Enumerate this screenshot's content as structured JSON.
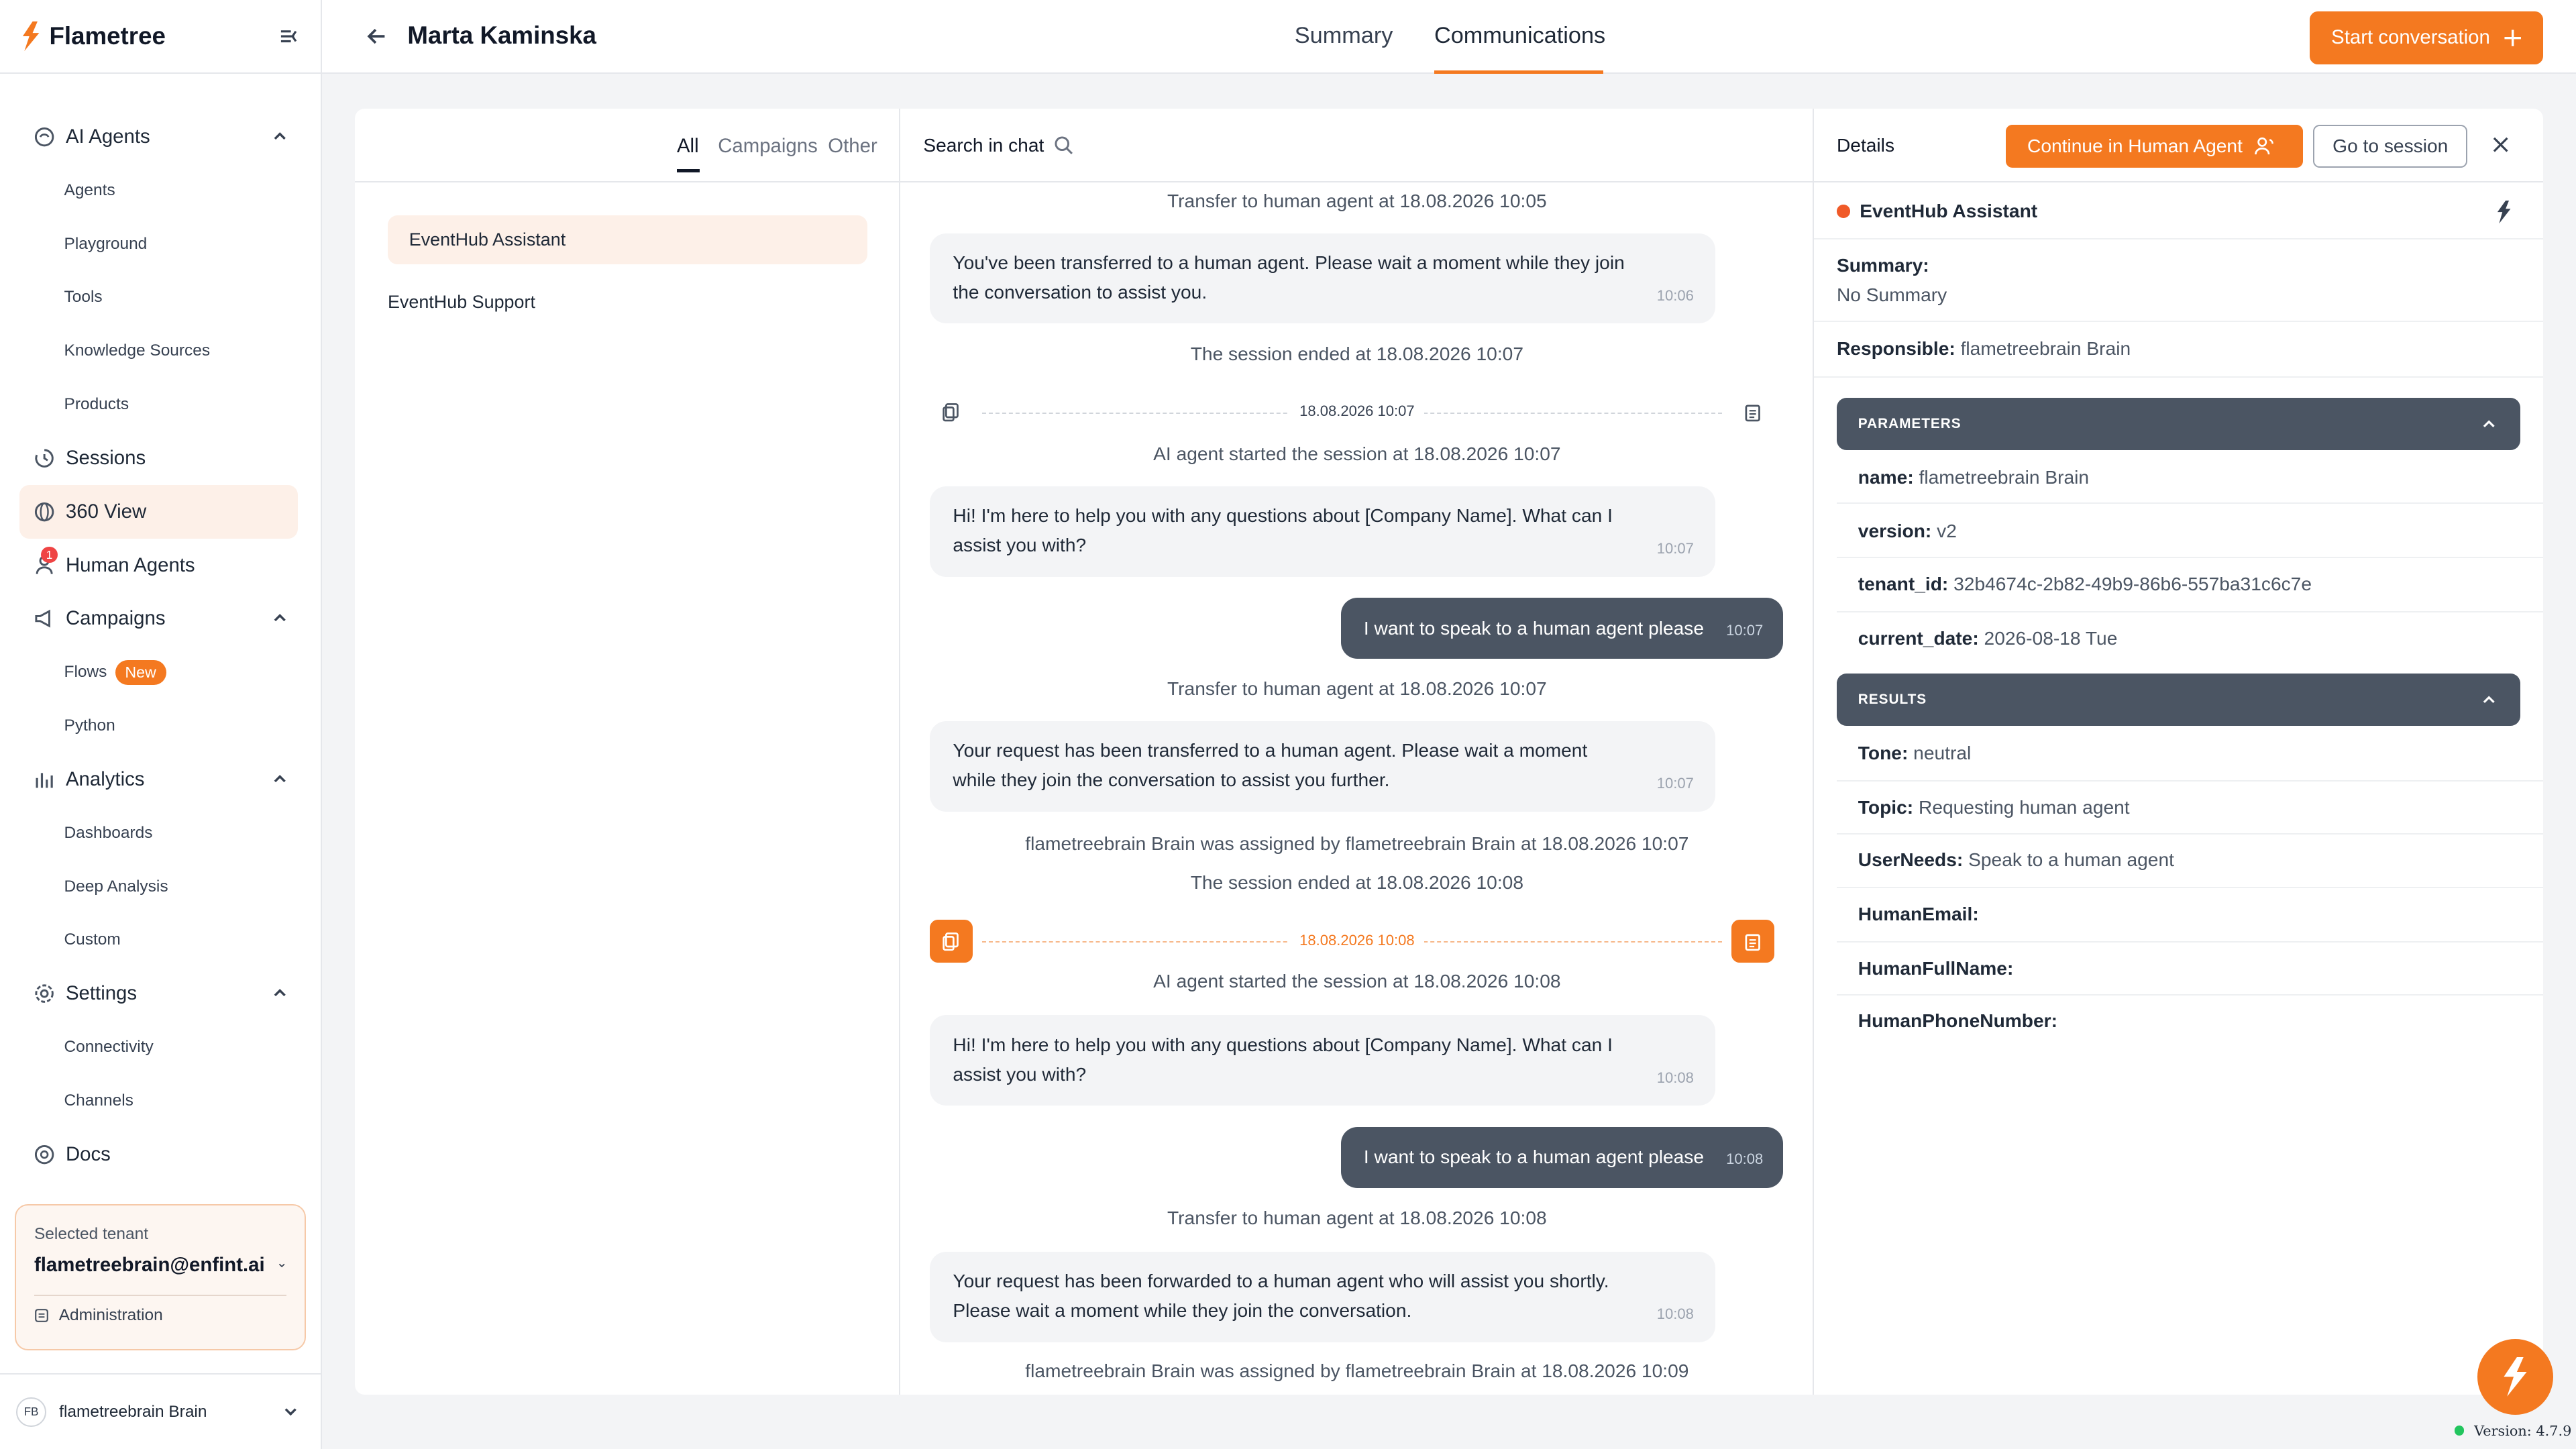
{
  "app": {
    "name": "Flametree",
    "accent": "#f47920"
  },
  "sidebar": {
    "items": [
      {
        "label": "AI Agents",
        "icon": "ai-agents-icon"
      },
      {
        "label": "Agents"
      },
      {
        "label": "Playground"
      },
      {
        "label": "Tools"
      },
      {
        "label": "Knowledge Sources"
      },
      {
        "label": "Products"
      },
      {
        "label": "Sessions",
        "icon": "sessions-icon"
      },
      {
        "label": "360 View",
        "icon": "globe-icon"
      },
      {
        "label": "Human Agents",
        "icon": "user-icon",
        "badge": "1"
      },
      {
        "label": "Campaigns",
        "icon": "megaphone-icon"
      },
      {
        "label": "Flows",
        "tag": "New"
      },
      {
        "label": "Python"
      },
      {
        "label": "Analytics",
        "icon": "chart-icon"
      },
      {
        "label": "Dashboards"
      },
      {
        "label": "Deep Analysis"
      },
      {
        "label": "Custom"
      },
      {
        "label": "Settings",
        "icon": "gear-icon"
      },
      {
        "label": "Connectivity"
      },
      {
        "label": "Channels"
      },
      {
        "label": "Docs",
        "icon": "docs-icon"
      }
    ],
    "tenant": {
      "label": "Selected tenant",
      "value": "flametreebrain@enfint.ai",
      "admin": "Administration"
    },
    "user": {
      "initials": "FB",
      "name": "flametreebrain Brain"
    }
  },
  "header": {
    "title": "Marta Kaminska",
    "tabs": [
      "Summary",
      "Communications"
    ],
    "start_button": "Start conversation"
  },
  "channels": {
    "filters": [
      "All",
      "Campaigns",
      "Other"
    ],
    "agents": [
      "EventHub Assistant",
      "EventHub Support"
    ]
  },
  "chat": {
    "search_label": "Search in chat",
    "messages": [
      {
        "type": "system",
        "text": "Transfer to human agent at 18.08.2026 10:05"
      },
      {
        "type": "bot",
        "text": "You've been transferred to a human agent. Please wait a moment while they join the conversation to assist you.",
        "time": "10:06"
      },
      {
        "type": "system",
        "text": "The session ended at 18.08.2026 10:07"
      },
      {
        "type": "divider",
        "date": "18.08.2026 10:07"
      },
      {
        "type": "system",
        "text": "AI agent started the session at 18.08.2026 10:07"
      },
      {
        "type": "bot",
        "text": "Hi! I'm here to help you with any questions about [Company Name]. What can I assist you with?",
        "time": "10:07"
      },
      {
        "type": "user",
        "text": "I want to speak to a human agent please",
        "time": "10:07"
      },
      {
        "type": "system",
        "text": "Transfer to human agent at 18.08.2026 10:07"
      },
      {
        "type": "bot",
        "text": "Your request has been transferred to a human agent. Please wait a moment while they join the conversation to assist you further.",
        "time": "10:07"
      },
      {
        "type": "system",
        "text": "flametreebrain Brain was assigned by flametreebrain Brain at 18.08.2026 10:07"
      },
      {
        "type": "system",
        "text": "The session ended at 18.08.2026 10:08"
      },
      {
        "type": "divider",
        "date": "18.08.2026 10:08"
      },
      {
        "type": "system",
        "text": "AI agent started the session at 18.08.2026 10:08"
      },
      {
        "type": "bot",
        "text": "Hi! I'm here to help you with any questions about [Company Name]. What can I assist you with?",
        "time": "10:08"
      },
      {
        "type": "user",
        "text": "I want to speak to a human agent please",
        "time": "10:08"
      },
      {
        "type": "system",
        "text": "Transfer to human agent at 18.08.2026 10:08"
      },
      {
        "type": "bot",
        "text": "Your request has been forwarded to a human agent who will assist you shortly. Please wait a moment while they join the conversation.",
        "time": "10:08"
      },
      {
        "type": "system",
        "text": "flametreebrain Brain was assigned by flametreebrain Brain at 18.08.2026 10:09"
      }
    ]
  },
  "details": {
    "title": "Details",
    "continue_button": "Continue in Human Agent",
    "goto_button": "Go to session",
    "agent_name": "EventHub Assistant",
    "summary_label": "Summary:",
    "summary_value": "No Summary",
    "responsible_label": "Responsible:",
    "responsible_value": "flametreebrain Brain",
    "parameters_title": "PARAMETERS",
    "parameters": [
      {
        "key": "name:",
        "value": "flametreebrain Brain"
      },
      {
        "key": "version:",
        "value": "v2"
      },
      {
        "key": "tenant_id:",
        "value": "32b4674c-2b82-49b9-86b6-557ba31c6c7e"
      },
      {
        "key": "current_date:",
        "value": "2026-08-18 Tue"
      }
    ],
    "results_title": "RESULTS",
    "results": [
      {
        "key": "Tone:",
        "value": "neutral"
      },
      {
        "key": "Topic:",
        "value": "Requesting human agent"
      },
      {
        "key": "UserNeeds:",
        "value": "Speak to a human agent"
      },
      {
        "key": "HumanEmail:",
        "value": ""
      },
      {
        "key": "HumanFullName:",
        "value": ""
      },
      {
        "key": "HumanPhoneNumber:",
        "value": ""
      }
    ]
  },
  "footer": {
    "version": "Version: 4.7.9"
  }
}
